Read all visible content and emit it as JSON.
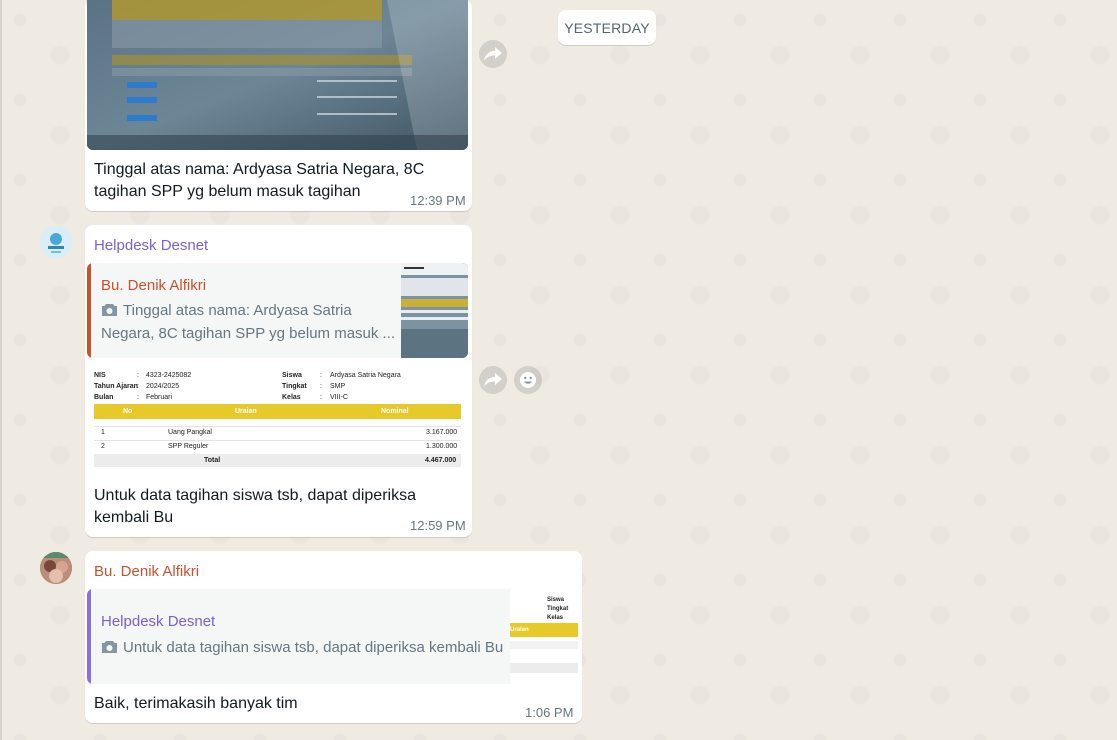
{
  "date_separator": "YESTERDAY",
  "messages": [
    {
      "text_line1": "Tinggal atas nama: Ardyasa Satria Negara, 8C",
      "text_line2": "tagihan SPP yg belum masuk tagihan",
      "time": "12:39 PM"
    },
    {
      "sender": "Helpdesk Desnet",
      "quote": {
        "author": "Bu. Denik Alfikri",
        "text_line1": "Tinggal atas nama: Ardyasa Satria",
        "text_line2": "Negara, 8C tagihan SPP yg belum masuk ..."
      },
      "invoice": {
        "nis_label": "NIS",
        "nis_value": "4323-2425082",
        "year_label": "Tahun Ajaran",
        "year_value": "2024/2025",
        "month_label": "Bulan",
        "month_value": "Februari",
        "student_label": "Siswa",
        "student_value": "Ardyasa Satria Negara",
        "level_label": "Tingkat",
        "level_value": "SMP",
        "class_label": "Kelas",
        "class_value": "VIII-C",
        "col_no": "No",
        "col_desc": "Uraian",
        "col_amount": "Nominal",
        "rows": [
          {
            "no": "1",
            "desc": "Uang Pangkal",
            "amount": "3.167.000"
          },
          {
            "no": "2",
            "desc": "SPP Reguler",
            "amount": "1.300.000"
          }
        ],
        "total_label": "Total",
        "total_value": "4.467.000"
      },
      "text_line1": "Untuk data tagihan siswa tsb, dapat diperiksa",
      "text_line2": "kembali Bu",
      "time": "12:59 PM"
    },
    {
      "sender": "Bu. Denik Alfikri",
      "quote": {
        "author": "Helpdesk Desnet",
        "text": "Untuk data tagihan siswa tsb, dapat diperiksa kembali Bu",
        "thumb_siswa": "Siswa",
        "thumb_tingkat": "Tingkat",
        "thumb_kelas": "Kelas",
        "thumb_uraian": "Uraian"
      },
      "text": "Baik, terimakasih banyak tim",
      "time": "1:06 PM"
    }
  ],
  "colors": {
    "helpdesk_name": "#7a5fd6",
    "denik_name": "#c8522d",
    "denik_quote_bar": "#c8522d",
    "helpdesk_quote_bar": "#8b6ee0",
    "invoice_header": "#e8c92a"
  }
}
